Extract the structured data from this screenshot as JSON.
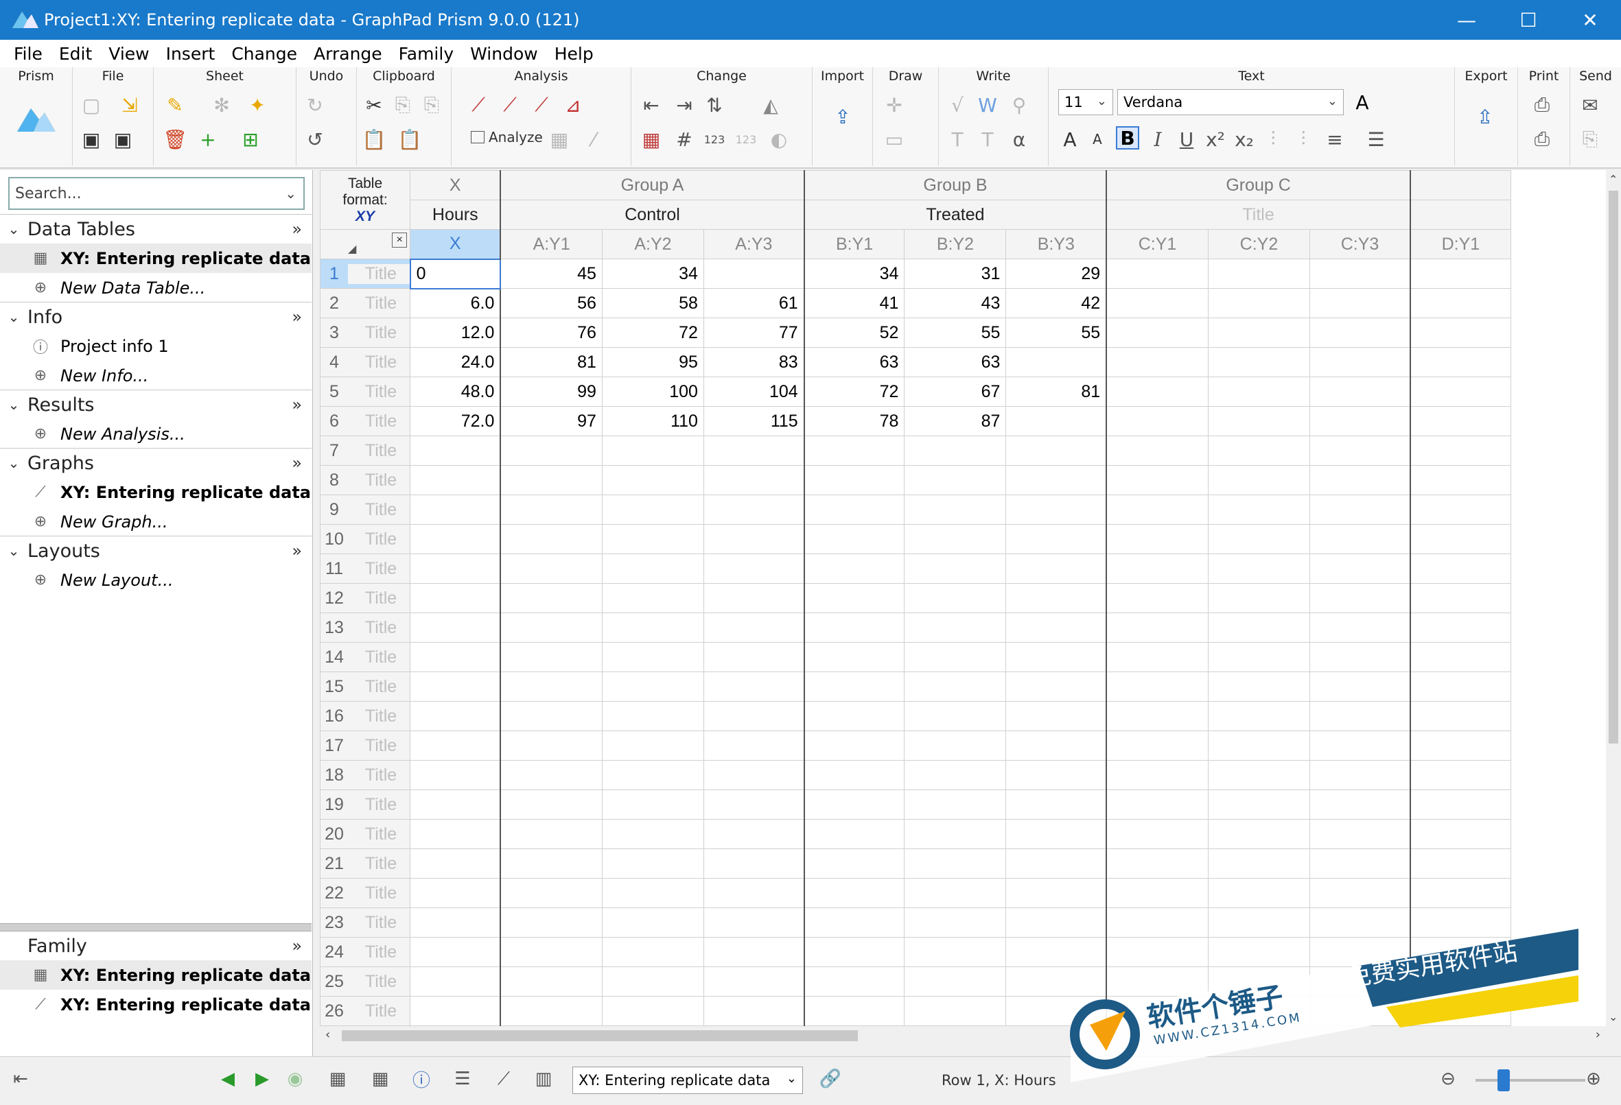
{
  "window": {
    "title": "Project1:XY: Entering replicate data - GraphPad Prism 9.0.0 (121)",
    "controls": {
      "minimize": "—",
      "maximize": "☐",
      "close": "✕"
    }
  },
  "menu": [
    "File",
    "Edit",
    "View",
    "Insert",
    "Change",
    "Arrange",
    "Family",
    "Window",
    "Help"
  ],
  "ribbon": {
    "groups": {
      "prism": "Prism",
      "file": "File",
      "sheet": "Sheet",
      "undo": "Undo",
      "clipboard": "Clipboard",
      "analysis": "Analysis",
      "change": "Change",
      "import": "Import",
      "draw": "Draw",
      "write": "Write",
      "text": "Text",
      "export": "Export",
      "print": "Print",
      "send": "Send"
    },
    "analyze_label": "Analyze",
    "font_size": "11",
    "font_name": "Verdana"
  },
  "navigator": {
    "search_placeholder": "Search...",
    "sections": {
      "data_tables": {
        "title": "Data Tables",
        "items": [
          "XY: Entering replicate data",
          "New Data Table..."
        ]
      },
      "info": {
        "title": "Info",
        "items": [
          "Project info 1",
          "New Info..."
        ]
      },
      "results": {
        "title": "Results",
        "items": [
          "New Analysis..."
        ]
      },
      "graphs": {
        "title": "Graphs",
        "items": [
          "XY: Entering replicate data",
          "New Graph..."
        ]
      },
      "layouts": {
        "title": "Layouts",
        "items": [
          "New Layout..."
        ]
      }
    },
    "family": {
      "title": "Family",
      "items": [
        "XY: Entering replicate data",
        "XY: Entering replicate data"
      ]
    }
  },
  "sheet": {
    "table_format_label": "Table format:",
    "table_format_value": "XY",
    "x_group": "X",
    "x_title": "Hours",
    "x_sub": "X",
    "groups": [
      {
        "name": "Group A",
        "title": "Control",
        "cols": [
          "A:Y1",
          "A:Y2",
          "A:Y3"
        ]
      },
      {
        "name": "Group B",
        "title": "Treated",
        "cols": [
          "B:Y1",
          "B:Y2",
          "B:Y3"
        ]
      },
      {
        "name": "Group C",
        "title": "Title",
        "cols": [
          "C:Y1",
          "C:Y2",
          "C:Y3"
        ]
      },
      {
        "name": "",
        "title": "",
        "cols": [
          "D:Y1"
        ]
      }
    ],
    "row_title_placeholder": "Title",
    "rows": [
      {
        "x": "0",
        "y": [
          "45",
          "34",
          "",
          "34",
          "31",
          "29",
          "",
          "",
          "",
          ""
        ]
      },
      {
        "x": "6.0",
        "y": [
          "56",
          "58",
          "61",
          "41",
          "43",
          "42",
          "",
          "",
          "",
          ""
        ]
      },
      {
        "x": "12.0",
        "y": [
          "76",
          "72",
          "77",
          "52",
          "55",
          "55",
          "",
          "",
          "",
          ""
        ]
      },
      {
        "x": "24.0",
        "y": [
          "81",
          "95",
          "83",
          "63",
          "63",
          "",
          "",
          "",
          "",
          ""
        ]
      },
      {
        "x": "48.0",
        "y": [
          "99",
          "100",
          "104",
          "72",
          "67",
          "81",
          "",
          "",
          "",
          ""
        ]
      },
      {
        "x": "72.0",
        "y": [
          "97",
          "110",
          "115",
          "78",
          "87",
          "",
          "",
          "",
          "",
          ""
        ]
      }
    ],
    "row_count": 27
  },
  "statusbar": {
    "sheet_selector": "XY: Entering replicate data",
    "status_text": "Row 1, X: Hours"
  },
  "watermark": {
    "brand": "软件个锤子",
    "url": "WWW.CZ1314.COM",
    "slogan": "免费实用软件站"
  }
}
